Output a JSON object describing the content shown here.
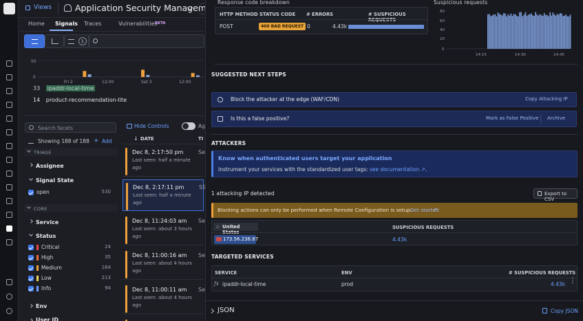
{
  "header": {
    "views_label": "Views",
    "app_title": "Application Security Management"
  },
  "tabs": [
    {
      "label": "Home"
    },
    {
      "label": "Signals"
    },
    {
      "label": "Traces"
    },
    {
      "label": "Vulnerabilities"
    }
  ],
  "beta_badge": "BETA",
  "toolbar": {
    "filter_count": "1"
  },
  "minichart": {
    "y_ticks": [
      "50",
      "0"
    ],
    "x_labels": [
      "Fri 2",
      "12:00",
      "Sat 3",
      "12:00"
    ],
    "bars": [
      {
        "pos": 0.27,
        "v": 18,
        "c": "#f0a03c"
      },
      {
        "pos": 0.3,
        "v": 8,
        "c": "#8aa8e0"
      },
      {
        "pos": 0.62,
        "v": 22,
        "c": "#f0a03c"
      },
      {
        "pos": 0.65,
        "v": 6,
        "c": "#8aa8e0"
      },
      {
        "pos": 0.92,
        "v": 12,
        "c": "#f0a03c"
      },
      {
        "pos": 0.95,
        "v": 5,
        "c": "#8aa8e0"
      }
    ]
  },
  "ranklist": [
    {
      "rank": "33",
      "name": "ipaddr-local-time"
    },
    {
      "rank": "14",
      "name": "product-recommendation-lite"
    }
  ],
  "facets": {
    "search_placeholder": "Search facets",
    "showing": "Showing 188 of 188",
    "add_label": "Add",
    "hide_controls": "Hide Controls",
    "triage": "TRIAGE",
    "assignee": "Assignee",
    "signal_state": "Signal State",
    "state_items": [
      {
        "label": "open",
        "count": "530"
      }
    ],
    "core": "CORE",
    "service": "Service",
    "status": "Status",
    "status_items": [
      {
        "label": "Critical",
        "count": "24",
        "color": "#e5484d"
      },
      {
        "label": "High",
        "count": "35",
        "color": "#f06a3c"
      },
      {
        "label": "Medium",
        "count": "164",
        "color": "#f0a03c"
      },
      {
        "label": "Low",
        "count": "213",
        "color": "#f3d35a"
      },
      {
        "label": "Info",
        "count": "94",
        "color": "#6ea0ff"
      }
    ],
    "env": "Env",
    "user_id": "User ID"
  },
  "signals": {
    "date_header": "DATE",
    "items": [
      {
        "time": "Dec 8, 2:17:50 pm",
        "seen": "Last seen: half a minute ago",
        "right": "Se"
      },
      {
        "time": "Dec 8, 2:17:11 pm",
        "seen": "Last seen: half a minute ago",
        "right": "SS"
      },
      {
        "time": "Dec 8, 11:24:03 am",
        "seen": "Last seen: about 3 hours ago",
        "right": "Se"
      },
      {
        "time": "Dec 8, 11:00:16 am",
        "seen": "Last seen: about 4 hours ago",
        "right": "Se"
      },
      {
        "time": "Dec 8, 11:00:11 am",
        "seen": "Last seen: about 4 hours ago",
        "right": "Se"
      }
    ]
  },
  "response": {
    "title": "Response code breakdown",
    "headers": [
      "HTTP METHOD",
      "STATUS CODE",
      "# ERRORS",
      "# SUSPICIOUS REQUESTS"
    ],
    "row": {
      "method": "POST",
      "status": "400 BAD REQUEST",
      "errors": "0",
      "suspicious": "4.43k",
      "fill": 1.0
    }
  },
  "suspicious_chart": {
    "title": "Suspicious requests",
    "y_ticks": [
      "80",
      "60",
      "40",
      "20",
      "0"
    ],
    "x_labels": [
      "14:15",
      "14:30",
      "14:45"
    ],
    "ymax": 80
  },
  "next_steps": {
    "title": "SUGGESTED NEXT STEPS",
    "block_text": "Block the attacker at the edge (WAF/CDN)",
    "copy_ip": "Copy Attacking IP",
    "false_pos": "Is this a false positive?",
    "mark_fp": "Mark as False Positive",
    "archive": "Archive"
  },
  "attackers": {
    "title": "ATTACKERS",
    "know_title": "Know when authenticated users target your application",
    "know_text": "Instrument your services with the standardized user tags: ",
    "know_link": "see documentation",
    "ip_count": "1 attacking IP detected",
    "export": "Export to CSV",
    "warning": "Blocking actions can only be performed when Remote Configuration is setup.",
    "get_started": "Get started",
    "country": "United States",
    "susp_header": "SUSPICIOUS REQUESTS",
    "ip": "173.56.236.87",
    "ip_susp": "4.43k"
  },
  "targeted": {
    "title": "TARGETED SERVICES",
    "headers": [
      "SERVICE",
      "ENV",
      "# SUSPICIOUS REQUESTS"
    ],
    "row": {
      "service": "ipaddr-local-time",
      "env": "prod",
      "count": "4.43k"
    }
  },
  "json": {
    "label": "JSON",
    "copy": "Copy JSON"
  }
}
